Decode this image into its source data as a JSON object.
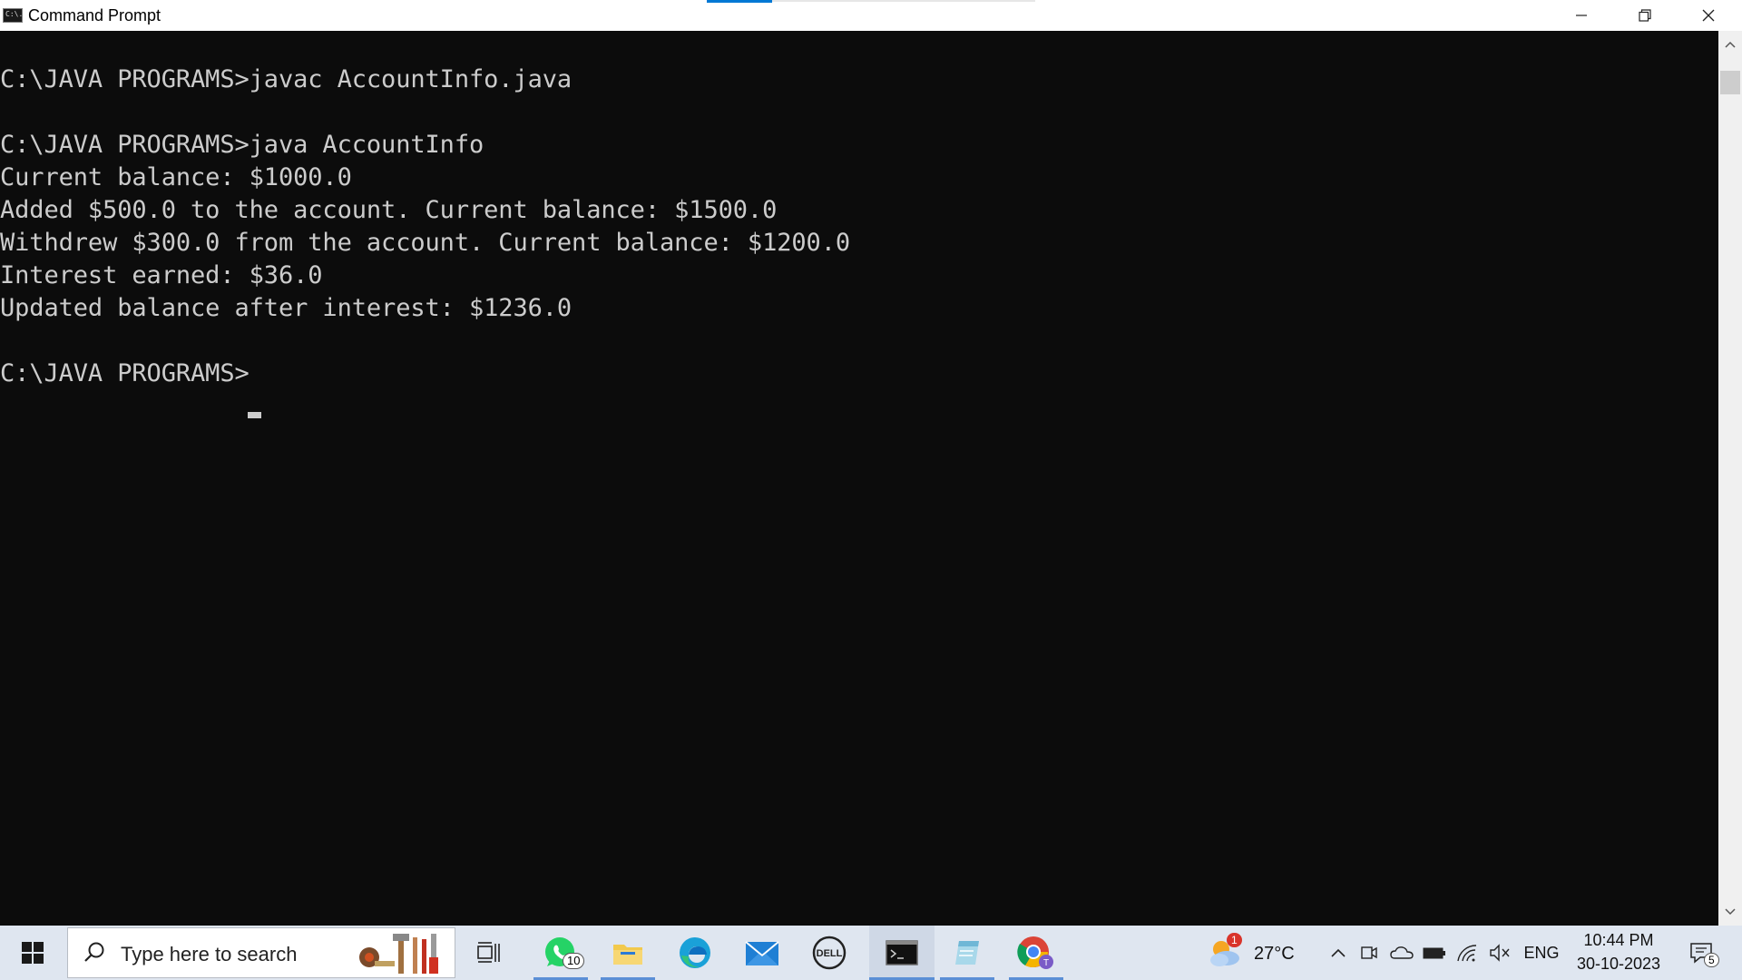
{
  "window": {
    "title": "Command Prompt",
    "icon_label": "C:\\."
  },
  "console": {
    "lines": [
      "C:\\JAVA PROGRAMS>javac AccountInfo.java",
      "",
      "C:\\JAVA PROGRAMS>java AccountInfo",
      "Current balance: $1000.0",
      "Added $500.0 to the account. Current balance: $1500.0",
      "Withdrew $300.0 from the account. Current balance: $1200.0",
      "Interest earned: $36.0",
      "Updated balance after interest: $1236.0",
      "",
      "C:\\JAVA PROGRAMS>"
    ]
  },
  "taskbar": {
    "search_placeholder": "Type here to search",
    "whatsapp_badge": "10",
    "weather_temp": "27°C",
    "weather_badge": "1",
    "language": "ENG",
    "time": "10:44 PM",
    "date": "30-10-2023",
    "notifications_count": "5"
  },
  "colors": {
    "console_bg": "#0c0c0c",
    "console_text": "#cccccc",
    "taskbar_bg": "#dfe6f0",
    "accent": "#0078d4"
  }
}
